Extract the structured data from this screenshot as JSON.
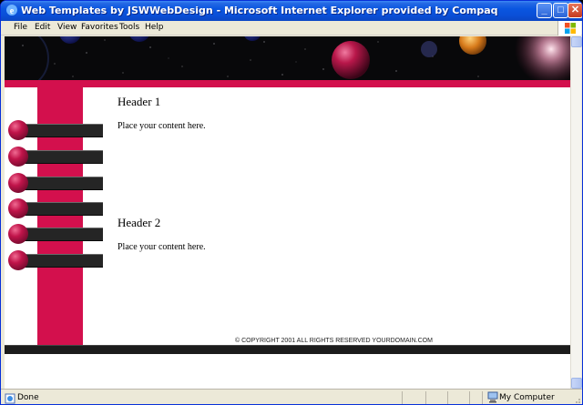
{
  "window": {
    "title": "Web Templates by JSWWebDesign - Microsoft Internet Explorer provided by Compaq",
    "min_glyph": "_",
    "max_glyph": "□",
    "close_glyph": "✕"
  },
  "menu": {
    "items": [
      {
        "label": "File"
      },
      {
        "label": "Edit"
      },
      {
        "label": "View"
      },
      {
        "label": "Favorites"
      },
      {
        "label": "Tools"
      },
      {
        "label": "Help"
      }
    ]
  },
  "page": {
    "banner_icon": "planets-starfield",
    "accent_color": "#d3104d",
    "nav_button_count": 6,
    "sections": [
      {
        "heading": "Header 1",
        "body": "Place your content here."
      },
      {
        "heading": "Header 2",
        "body": "Place your content here."
      }
    ],
    "copyright": "© COPYRIGHT 2001 ALL RIGHTS RESERVED YOURDOMAIN.COM"
  },
  "status": {
    "text": "Done",
    "zone": "My Computer"
  },
  "icons": {
    "title": "ie-icon",
    "status": "page-done-icon",
    "zone": "my-computer-icon",
    "brand": "windows-logo-icon"
  }
}
